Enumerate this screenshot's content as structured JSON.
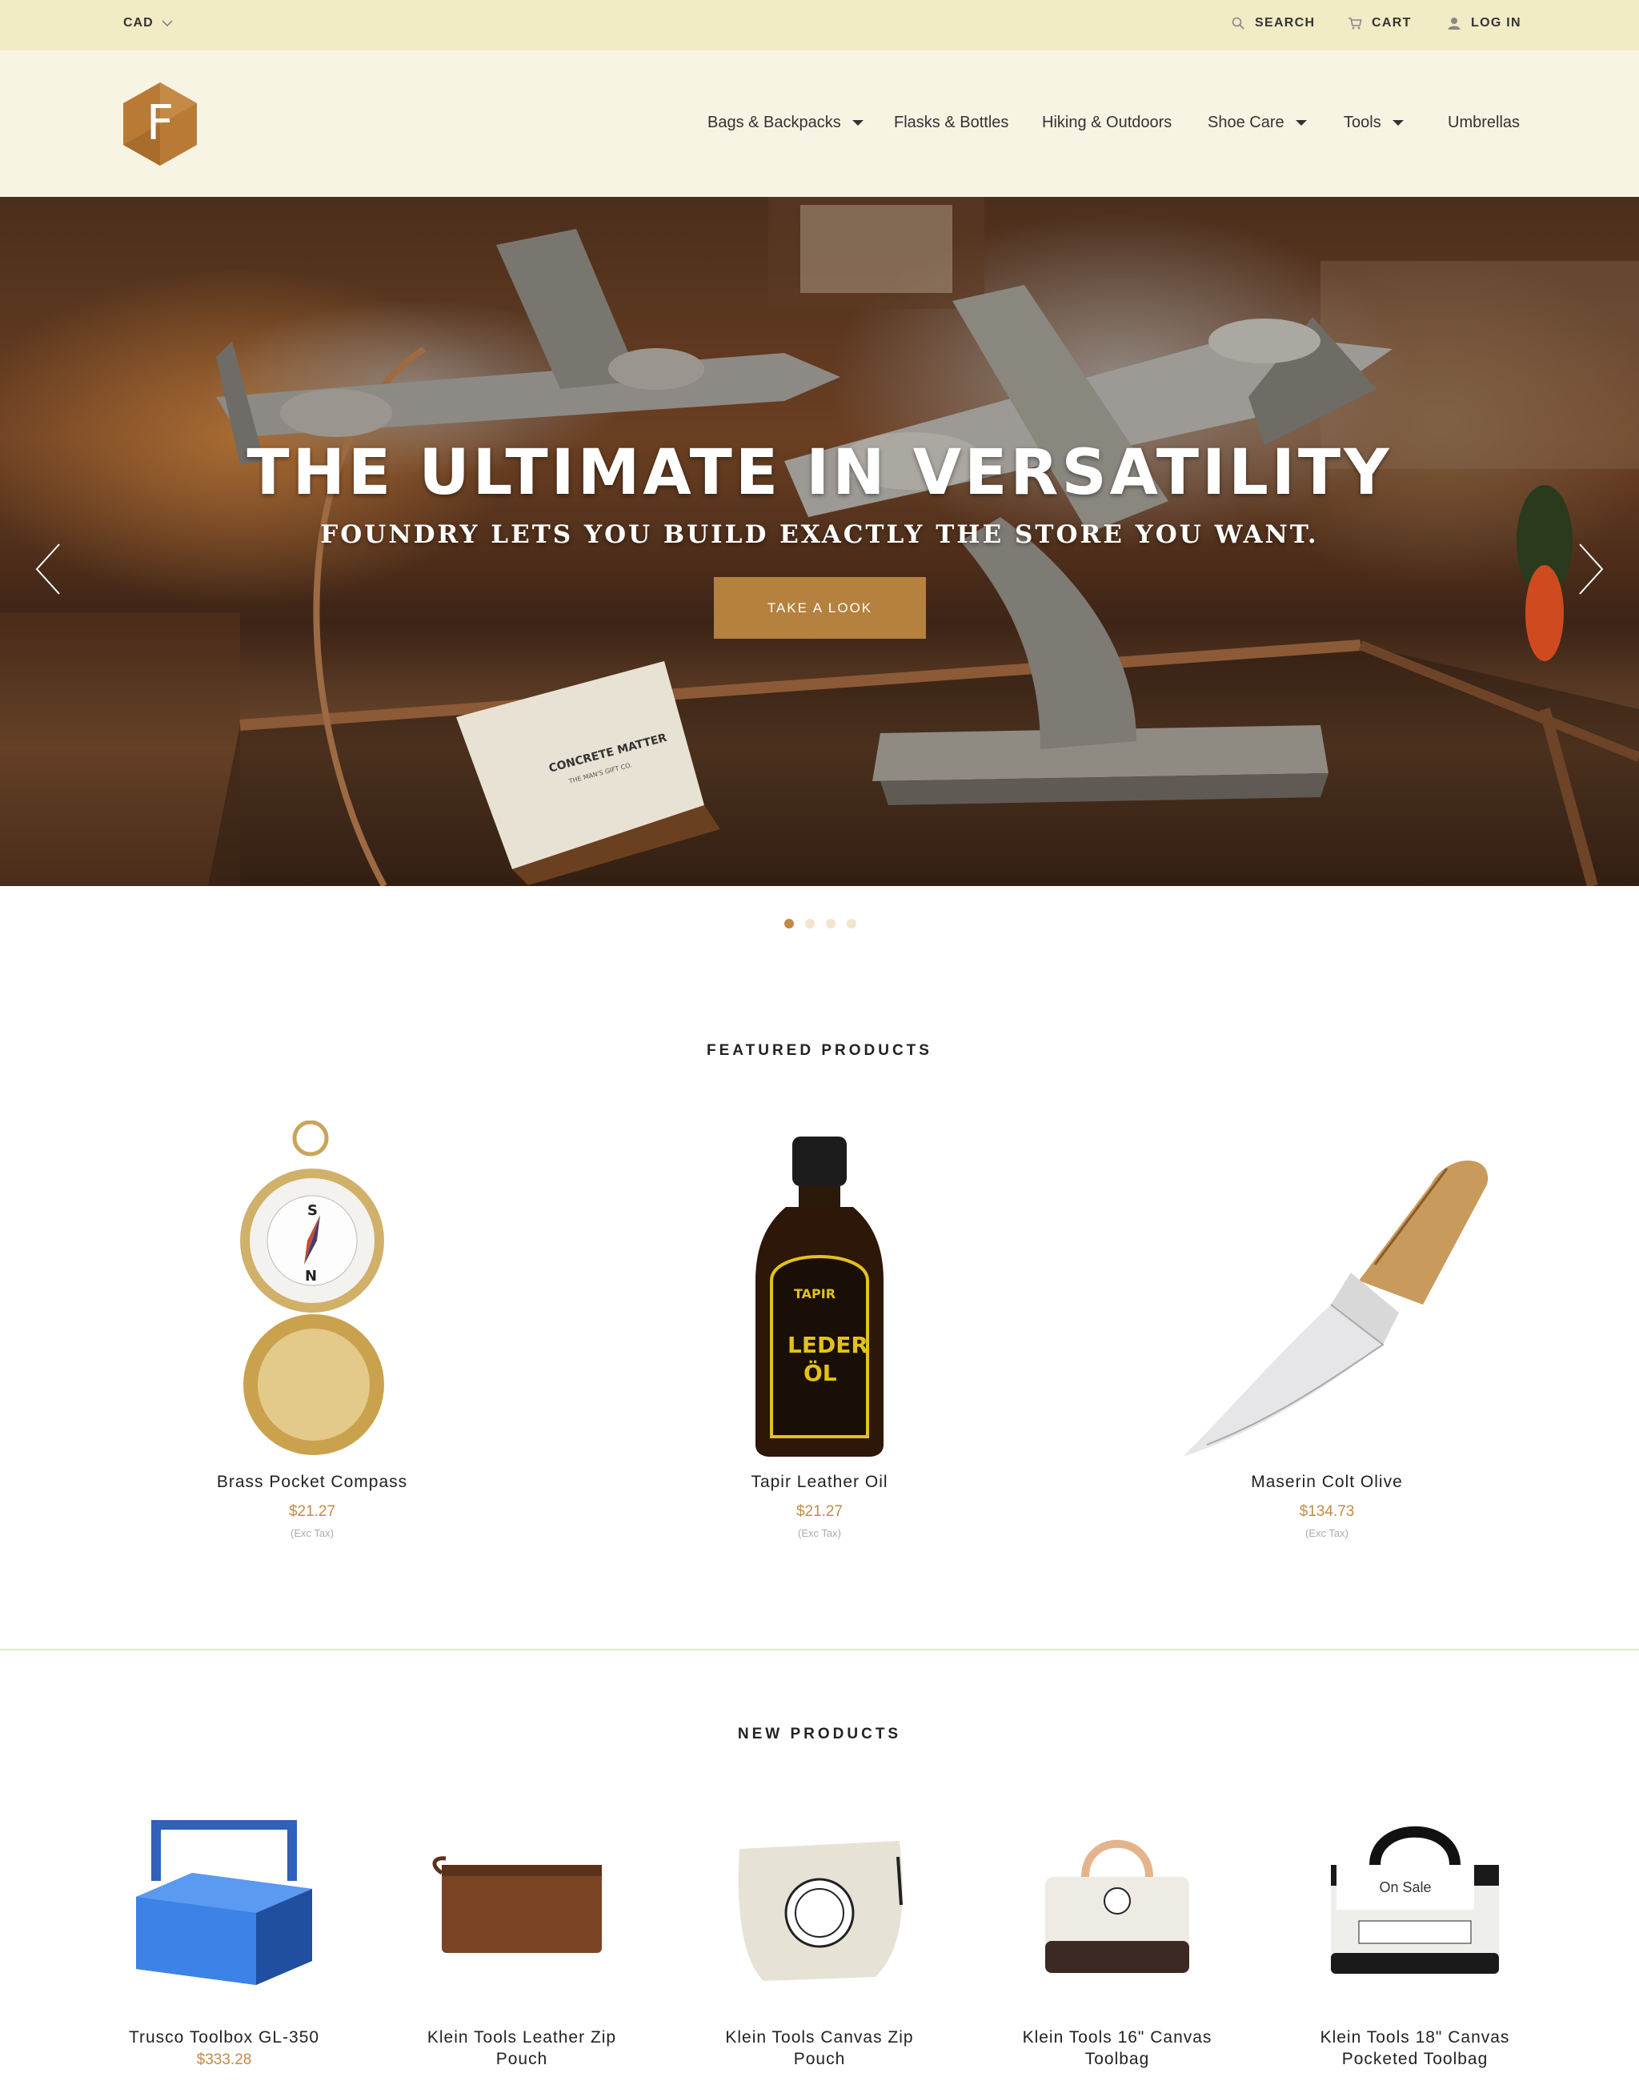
{
  "topbar": {
    "currency": "CAD",
    "search_label": "SEARCH",
    "cart_label": "CART",
    "login_label": "LOG IN"
  },
  "logo": {
    "letter": "F",
    "color": "#b97a35"
  },
  "nav": {
    "items": [
      {
        "label": "Bags & Backpacks",
        "dropdown": true
      },
      {
        "label": "Flasks & Bottles",
        "dropdown": false
      },
      {
        "label": "Hiking & Outdoors",
        "dropdown": false
      },
      {
        "label": "Shoe Care",
        "dropdown": true
      },
      {
        "label": "Tools",
        "dropdown": true
      },
      {
        "label": "Umbrellas",
        "dropdown": false
      }
    ]
  },
  "hero": {
    "title": "THE ULTIMATE IN VERSATILITY",
    "subtitle": "FOUNDRY LETS YOU BUILD EXACTLY THE STORE YOU WANT.",
    "button_label": "TAKE A LOOK",
    "card_text_1": "CONCRETE MATTER",
    "card_text_2": "THE MAN'S GIFT CO.",
    "slides": 4,
    "active_slide": 1
  },
  "featured": {
    "title": "FEATURED PRODUCTS",
    "products": [
      {
        "name": "Brass Pocket Compass",
        "price": "$21.27",
        "tax": "(Exc Tax)"
      },
      {
        "name": "Tapir Leather Oil",
        "price": "$21.27",
        "tax": "(Exc Tax)"
      },
      {
        "name": "Maserin Colt Olive",
        "price": "$134.73",
        "tax": "(Exc Tax)"
      }
    ]
  },
  "new_products": {
    "title": "NEW PRODUCTS",
    "products": [
      {
        "name": "Trusco Toolbox GL-350",
        "price": "$333.28"
      },
      {
        "name": "Klein Tools Leather Zip Pouch",
        "price": ""
      },
      {
        "name": "Klein Tools Canvas Zip Pouch",
        "price": ""
      },
      {
        "name": "Klein Tools 16\" Canvas Toolbag",
        "price": ""
      },
      {
        "name": "Klein Tools 18\" Canvas Pocketed Toolbag",
        "price": "",
        "badge": "On Sale"
      }
    ]
  },
  "colors": {
    "topbar_bg": "#f1ebc6",
    "header_bg": "#f8f4e3",
    "accent": "#b5813f",
    "price": "#c48a45"
  }
}
